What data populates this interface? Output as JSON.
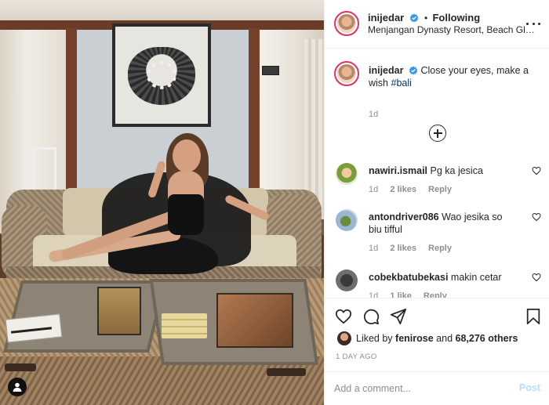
{
  "post": {
    "username": "inijedar",
    "separator": "•",
    "follow_state": "Following",
    "location": "Menjangan Dynasty Resort, Beach Glamping ...",
    "more_icon": "more-horizontal-icon",
    "verified_icon": "verified-badge-icon"
  },
  "caption": {
    "username": "inijedar",
    "text": "Close your eyes, make a wish",
    "hashtag": "#bali",
    "time": "1d"
  },
  "load_more_icon": "plus-circle-icon",
  "comments": [
    {
      "username": "nawiri.ismail",
      "text": "Pg ka jesica",
      "time": "1d",
      "likes": "2 likes",
      "reply": "Reply"
    },
    {
      "username": "antondriver086",
      "text": "Wao jesika so biu tifful",
      "time": "1d",
      "likes": "2 likes",
      "reply": "Reply"
    },
    {
      "username": "cobekbatubekasi",
      "text": "makin cetar",
      "time": "1d",
      "likes": "1 like",
      "reply": "Reply"
    }
  ],
  "actions": {
    "icons": [
      "heart-icon",
      "comment-icon",
      "share-icon",
      "bookmark-icon"
    ]
  },
  "likes": {
    "prefix": "Liked by",
    "user": "fenirose",
    "joiner": "and",
    "others": "68,276 others"
  },
  "posted_ago": "1 DAY AGO",
  "comment_box": {
    "placeholder": "Add a comment...",
    "post_label": "Post"
  },
  "colors": {
    "accent_link": "#00376b",
    "post_disabled": "#b2dffc",
    "verified": "#3897f0",
    "story_ring": "#e1306c"
  }
}
